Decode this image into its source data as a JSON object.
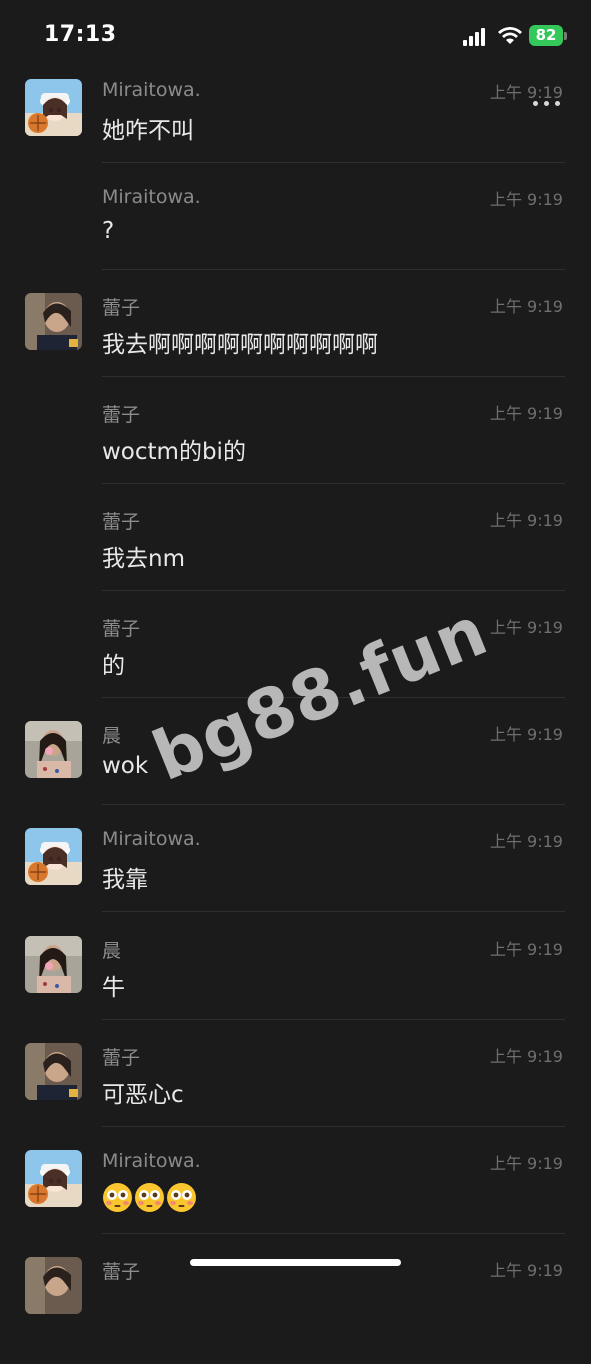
{
  "status_bar": {
    "time": "17:13",
    "battery": "82",
    "icons": [
      "signal-icon",
      "wifi-icon",
      "battery-icon"
    ]
  },
  "header": {
    "more_icon": "more-icon"
  },
  "messages": [
    {
      "sender": "Miraitowa.",
      "time": "上午 9:19",
      "text": "她咋不叫",
      "avatar": "anime-girl"
    },
    {
      "sender": "Miraitowa.",
      "time": "上午 9:19",
      "text": "?",
      "avatar": null
    },
    {
      "sender": "蕾子",
      "time": "上午 9:19",
      "text": "我去啊啊啊啊啊啊啊啊啊啊",
      "avatar": "photo-girl-1"
    },
    {
      "sender": "蕾子",
      "time": "上午 9:19",
      "text": "woctm的bi的",
      "avatar": null
    },
    {
      "sender": "蕾子",
      "time": "上午 9:19",
      "text": "我去nm",
      "avatar": null
    },
    {
      "sender": "蕾子",
      "time": "上午 9:19",
      "text": "的",
      "avatar": null
    },
    {
      "sender": "晨",
      "time": "上午 9:19",
      "text": "wok",
      "avatar": "photo-girl-2"
    },
    {
      "sender": "Miraitowa.",
      "time": "上午 9:19",
      "text": "我靠",
      "avatar": "anime-girl"
    },
    {
      "sender": "晨",
      "time": "上午 9:19",
      "text": "牛",
      "avatar": "photo-girl-2"
    },
    {
      "sender": "蕾子",
      "time": "上午 9:19",
      "text": "可恶心c",
      "avatar": "photo-girl-1"
    },
    {
      "sender": "Miraitowa.",
      "time": "上午 9:19",
      "text": "",
      "emojis": [
        "flushed-face",
        "flushed-face",
        "flushed-face"
      ],
      "avatar": "anime-girl"
    },
    {
      "sender": "蕾子",
      "time": "上午 9:19",
      "text": "",
      "avatar": "photo-girl-1"
    }
  ],
  "watermark": "bg88.fun",
  "colors": {
    "background": "#1b1b1b",
    "sender": "#8b8b8b",
    "time": "#6f6f6f",
    "text": "#e8e8e8",
    "divider": "#2f2f2f",
    "battery": "#34c759"
  }
}
